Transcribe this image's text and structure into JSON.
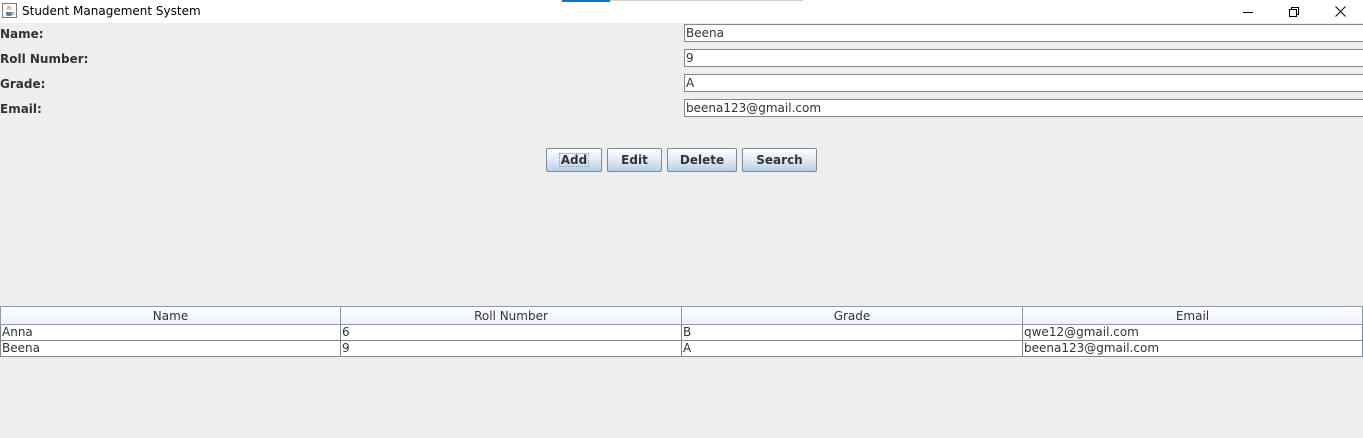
{
  "window": {
    "title": "Student Management System",
    "icon": "java-cup-icon",
    "controls": [
      "minimize-icon",
      "restore-icon",
      "close-icon"
    ]
  },
  "form": {
    "name_label": "Name:",
    "name_value": "Beena",
    "roll_label": "Roll Number:",
    "roll_value": "9",
    "grade_label": "Grade:",
    "grade_value": "A",
    "email_label": "Email:",
    "email_value": "beena123@gmail.com"
  },
  "buttons": {
    "add": "Add",
    "edit": "Edit",
    "delete": "Delete",
    "search": "Search"
  },
  "table": {
    "columns": [
      "Name",
      "Roll Number",
      "Grade",
      "Email"
    ],
    "rows": [
      [
        "Anna",
        "6",
        "B",
        "qwe12@gmail.com"
      ],
      [
        "Beena",
        "9",
        "A",
        "beena123@gmail.com"
      ]
    ]
  },
  "colors": {
    "window_bg": "#eeeeee",
    "titlebar_bg": "#ffffff",
    "accent": "#0078d7",
    "border": "#7a8a99"
  }
}
